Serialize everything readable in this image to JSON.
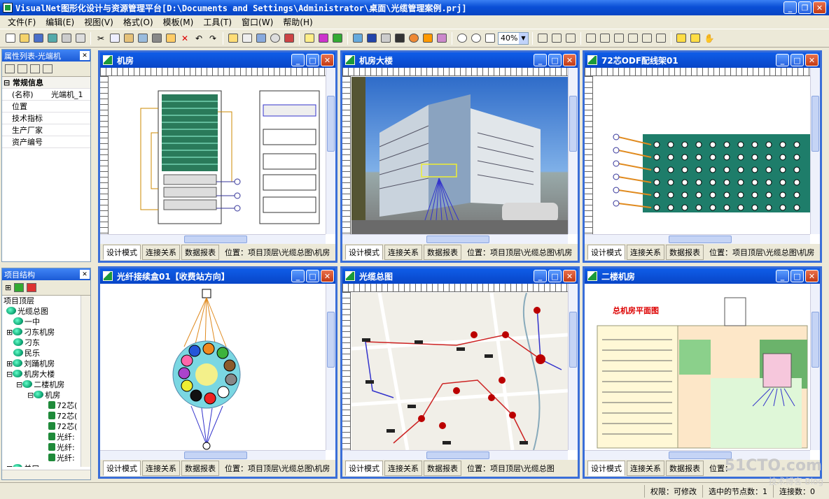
{
  "app": {
    "title": "VisualNet图形化设计与资源管理平台[D:\\Documents and Settings\\Administrator\\桌面\\光缆管理案例.prj]"
  },
  "menu": [
    "文件(F)",
    "编辑(E)",
    "视图(V)",
    "格式(O)",
    "模板(M)",
    "工具(T)",
    "窗口(W)",
    "帮助(H)"
  ],
  "toolbar": {
    "zoom": "40%"
  },
  "props_panel": {
    "title": "属性列表-光端机",
    "group": "常规信息",
    "rows": [
      {
        "k": "(名称)",
        "v": "光端机_1"
      },
      {
        "k": "位置",
        "v": ""
      },
      {
        "k": "技术指标",
        "v": ""
      },
      {
        "k": "生产厂家",
        "v": ""
      },
      {
        "k": "资产编号",
        "v": ""
      }
    ]
  },
  "tree_panel": {
    "title": "项目结构",
    "items": [
      {
        "label": "项目顶层",
        "indent": 0
      },
      {
        "label": "光缆总图",
        "indent": 1
      },
      {
        "label": "一中",
        "indent": 2
      },
      {
        "label": "刁东机房",
        "indent": 2
      },
      {
        "label": "刁东",
        "indent": 2
      },
      {
        "label": "民乐",
        "indent": 2
      },
      {
        "label": "刘踊机房",
        "indent": 2
      },
      {
        "label": "机房大楼",
        "indent": 2
      },
      {
        "label": "二楼机房",
        "indent": 3
      },
      {
        "label": "机房",
        "indent": 4
      },
      {
        "label": "72芯(",
        "indent": 5
      },
      {
        "label": "72芯(",
        "indent": 5
      },
      {
        "label": "72芯(",
        "indent": 5
      },
      {
        "label": "光纤:",
        "indent": 5
      },
      {
        "label": "光纤:",
        "indent": 5
      },
      {
        "label": "光纤:",
        "indent": 5
      },
      {
        "label": "关口",
        "indent": 2
      }
    ]
  },
  "windows": [
    {
      "title": "机房",
      "location": "位置：项目顶层\\光缆总图\\机房"
    },
    {
      "title": "机房大楼",
      "location": "位置：项目顶层\\光缆总图\\机房"
    },
    {
      "title": "72芯ODF配线架01",
      "location": "位置：项目顶层\\光缆总图\\机房"
    },
    {
      "title": "光纤接续盒01【收费站方向】",
      "location": "位置：项目顶层\\光缆总图\\机房"
    },
    {
      "title": "光缆总图",
      "location": "位置：项目顶层\\光缆总图"
    },
    {
      "title": "二楼机房",
      "location": "位置："
    }
  ],
  "tabs": {
    "design": "设计模式",
    "connect": "连接关系",
    "report": "数据报表"
  },
  "floorplan_title": "总机房平面图",
  "status": {
    "perm": "权限：可修改",
    "selected": "选中的节点数：1",
    "conn": "连接数：0"
  },
  "watermark": {
    "site": "51CTO.com",
    "sub": "技术博客 Blog"
  }
}
